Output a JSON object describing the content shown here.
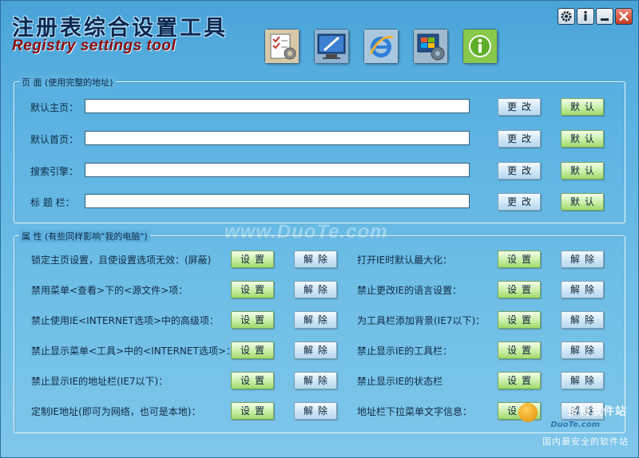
{
  "app": {
    "title_cn": "注册表综合设置工具",
    "title_en": "Registry settings tool"
  },
  "toolbar": {
    "icons": [
      {
        "name": "settings-checklist-icon"
      },
      {
        "name": "desktop-tools-icon"
      },
      {
        "name": "internet-explorer-icon"
      },
      {
        "name": "windows-settings-icon"
      },
      {
        "name": "info-icon"
      }
    ]
  },
  "window_controls": {
    "icons": [
      "gear-icon",
      "info-icon",
      "minimize-icon",
      "close-icon"
    ]
  },
  "page_group": {
    "legend": "页 面 (使用完整的地址)",
    "rows": [
      {
        "label": "默认主页：",
        "value": "",
        "change": "更改",
        "default": "默认"
      },
      {
        "label": "默认首页：",
        "value": "",
        "change": "更改",
        "default": "默认"
      },
      {
        "label": "搜索引擎：",
        "value": "",
        "change": "更改",
        "default": "默认"
      },
      {
        "label": "标 题 栏：",
        "value": "",
        "change": "更改",
        "default": "默认"
      }
    ]
  },
  "attr_group": {
    "legend": "属 性 (有些同样影响\"我的电脑\")",
    "rows": [
      {
        "left": {
          "label": "锁定主页设置，且使设置选项无效：(屏蔽)",
          "set": "设置",
          "unset": "解除"
        },
        "right": {
          "label": "打开IE时默认最大化：",
          "set": "设置",
          "unset": "解除"
        }
      },
      {
        "left": {
          "label": "禁用菜单<查看>下的<源文件>项：",
          "set": "设置",
          "unset": "解除"
        },
        "right": {
          "label": "禁止更改IE的语言设置：",
          "set": "设置",
          "unset": "解除"
        }
      },
      {
        "left": {
          "label": "禁止使用IE<INTERNET选项>中的高级项：",
          "set": "设置",
          "unset": "解除"
        },
        "right": {
          "label": "为工具栏添加背景(IE7以下)：",
          "set": "设置",
          "unset": "解除"
        }
      },
      {
        "left": {
          "label": "禁止显示菜单<工具>中的<INTERNET选项>：",
          "set": "设置",
          "unset": "解除"
        },
        "right": {
          "label": "禁止显示IE的工具栏：",
          "set": "设置",
          "unset": "解除"
        }
      },
      {
        "left": {
          "label": "禁止显示IE的地址栏(IE7以下)：",
          "set": "设置",
          "unset": "解除"
        },
        "right": {
          "label": "禁止显示IE的状态栏",
          "set": "设置",
          "unset": "解除"
        }
      },
      {
        "left": {
          "label": "定制IE地址(即可为网络，也可是本地)：",
          "set": "设置",
          "unset": "解除"
        },
        "right": {
          "label": "地址栏下拉菜单文字信息：",
          "set": "设置",
          "unset": "解除"
        }
      }
    ]
  },
  "watermark": {
    "text": "www.DuoTe.com",
    "corner_line1": "多特软件站",
    "corner_line2": "DuoTe.com",
    "corner_line3": "国内最安全的软件站"
  }
}
